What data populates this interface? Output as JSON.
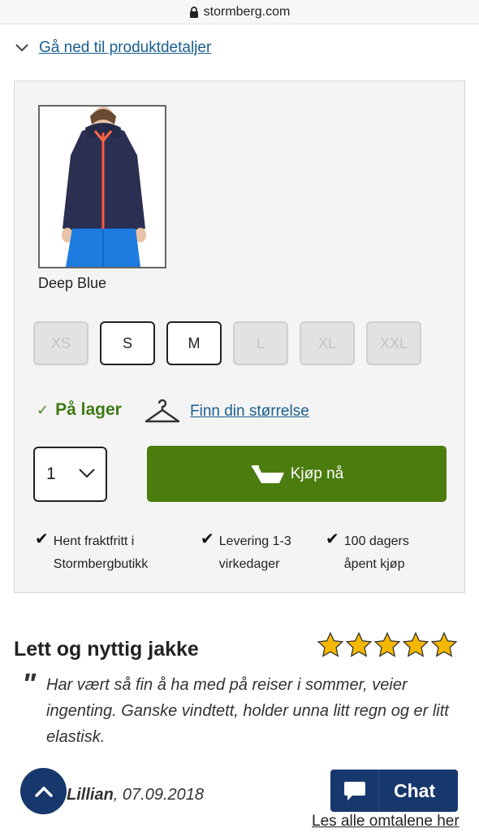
{
  "browser": {
    "url": "stormberg.com"
  },
  "jump_link": {
    "label": "Gå ned til produktdetaljer"
  },
  "product": {
    "color_name": "Deep Blue",
    "sizes": [
      {
        "label": "XS",
        "available": false
      },
      {
        "label": "S",
        "available": true
      },
      {
        "label": "M",
        "available": true
      },
      {
        "label": "L",
        "available": false
      },
      {
        "label": "XL",
        "available": false
      },
      {
        "label": "XXL",
        "available": false
      }
    ],
    "stock_status": "På lager",
    "size_finder_label": "Finn din størrelse",
    "quantity": "1",
    "buy_label": "Kjøp nå",
    "benefits": [
      {
        "line1": "Hent fraktfritt i",
        "line2": "Stormbergbutikk"
      },
      {
        "line1": "Levering 1-3",
        "line2": "virkedager"
      },
      {
        "line1": "100 dagers",
        "line2": "åpent kjøp"
      }
    ]
  },
  "review": {
    "title": "Lett og nyttig jakke",
    "rating": 5,
    "rating_max": 5,
    "quote_mark": "\"",
    "text": "Har vært så fin å ha med på reiser i sommer, veier ingenting. Ganske vindtett, holder unna litt regn og er litt elastisk.",
    "author": "Lillian",
    "date": ", 07.09.2018",
    "all_reviews_label": "Les alle omtalene her"
  },
  "chat": {
    "label": "Chat"
  },
  "colors": {
    "link": "#1a5f8f",
    "stock_green": "#3f7a14",
    "buy_button": "#4a7c0e",
    "navy": "#17386d",
    "star": "#f5b800"
  }
}
